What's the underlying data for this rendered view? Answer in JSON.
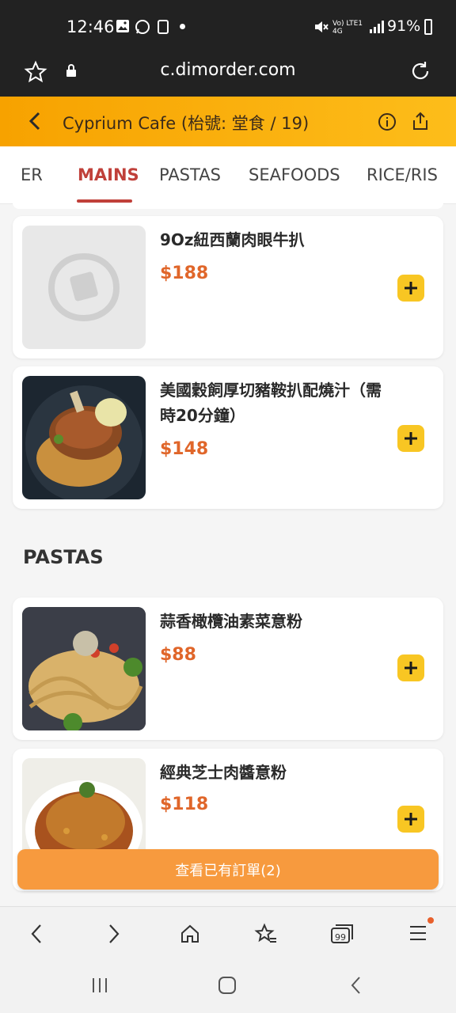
{
  "status_bar": {
    "time": "12:46",
    "battery": "91%",
    "network": "Vo) LTE1 4G"
  },
  "browser": {
    "url": "c.dimorder.com"
  },
  "header": {
    "title": "Cyprium Cafe (枱號: 堂食 / 19)"
  },
  "tabs": [
    {
      "label": "ER"
    },
    {
      "label": "MAINS"
    },
    {
      "label": "PASTAS"
    },
    {
      "label": "SEAFOODS"
    },
    {
      "label": "RICE/RIS"
    }
  ],
  "active_tab": "MAINS",
  "mains": {
    "items": [
      {
        "name": "9Oz紐西蘭肉眼牛扒",
        "price": "$188",
        "image": "placeholder-logo"
      },
      {
        "name": "美國穀飼厚切豬鞍扒配燒汁（需時20分鐘）",
        "price": "$148",
        "image": "pork-chop"
      }
    ]
  },
  "pastas": {
    "title": "PASTAS",
    "items": [
      {
        "name": "蒜香橄欖油素菜意粉",
        "price": "$88",
        "image": "garlic-pasta"
      },
      {
        "name": "經典芝士肉醬意粉",
        "price": "$118",
        "image": "bolognese"
      }
    ]
  },
  "order_bar": {
    "label": "查看已有訂單(2)"
  },
  "colors": {
    "header_start": "#f7a200",
    "header_end": "#fdbd1a",
    "price": "#e0662a",
    "active_tab": "#c0403a",
    "add_button": "#f8c623",
    "order_bar": "#f79a3e"
  },
  "icons": {
    "status": [
      "photo-icon",
      "whatsapp-icon",
      "app-icon",
      "mute-icon",
      "signal-icon",
      "battery-icon"
    ],
    "browser": [
      "bookmark-star-icon",
      "lock-icon",
      "reload-icon"
    ],
    "header": [
      "back-icon",
      "info-icon",
      "share-icon"
    ],
    "bottom_nav": [
      "back-arrow-icon",
      "forward-arrow-icon",
      "home-icon",
      "bookmarks-icon",
      "tabs-icon",
      "menu-icon"
    ],
    "system_nav": [
      "recents-icon",
      "home-pill-icon",
      "back-icon"
    ]
  }
}
